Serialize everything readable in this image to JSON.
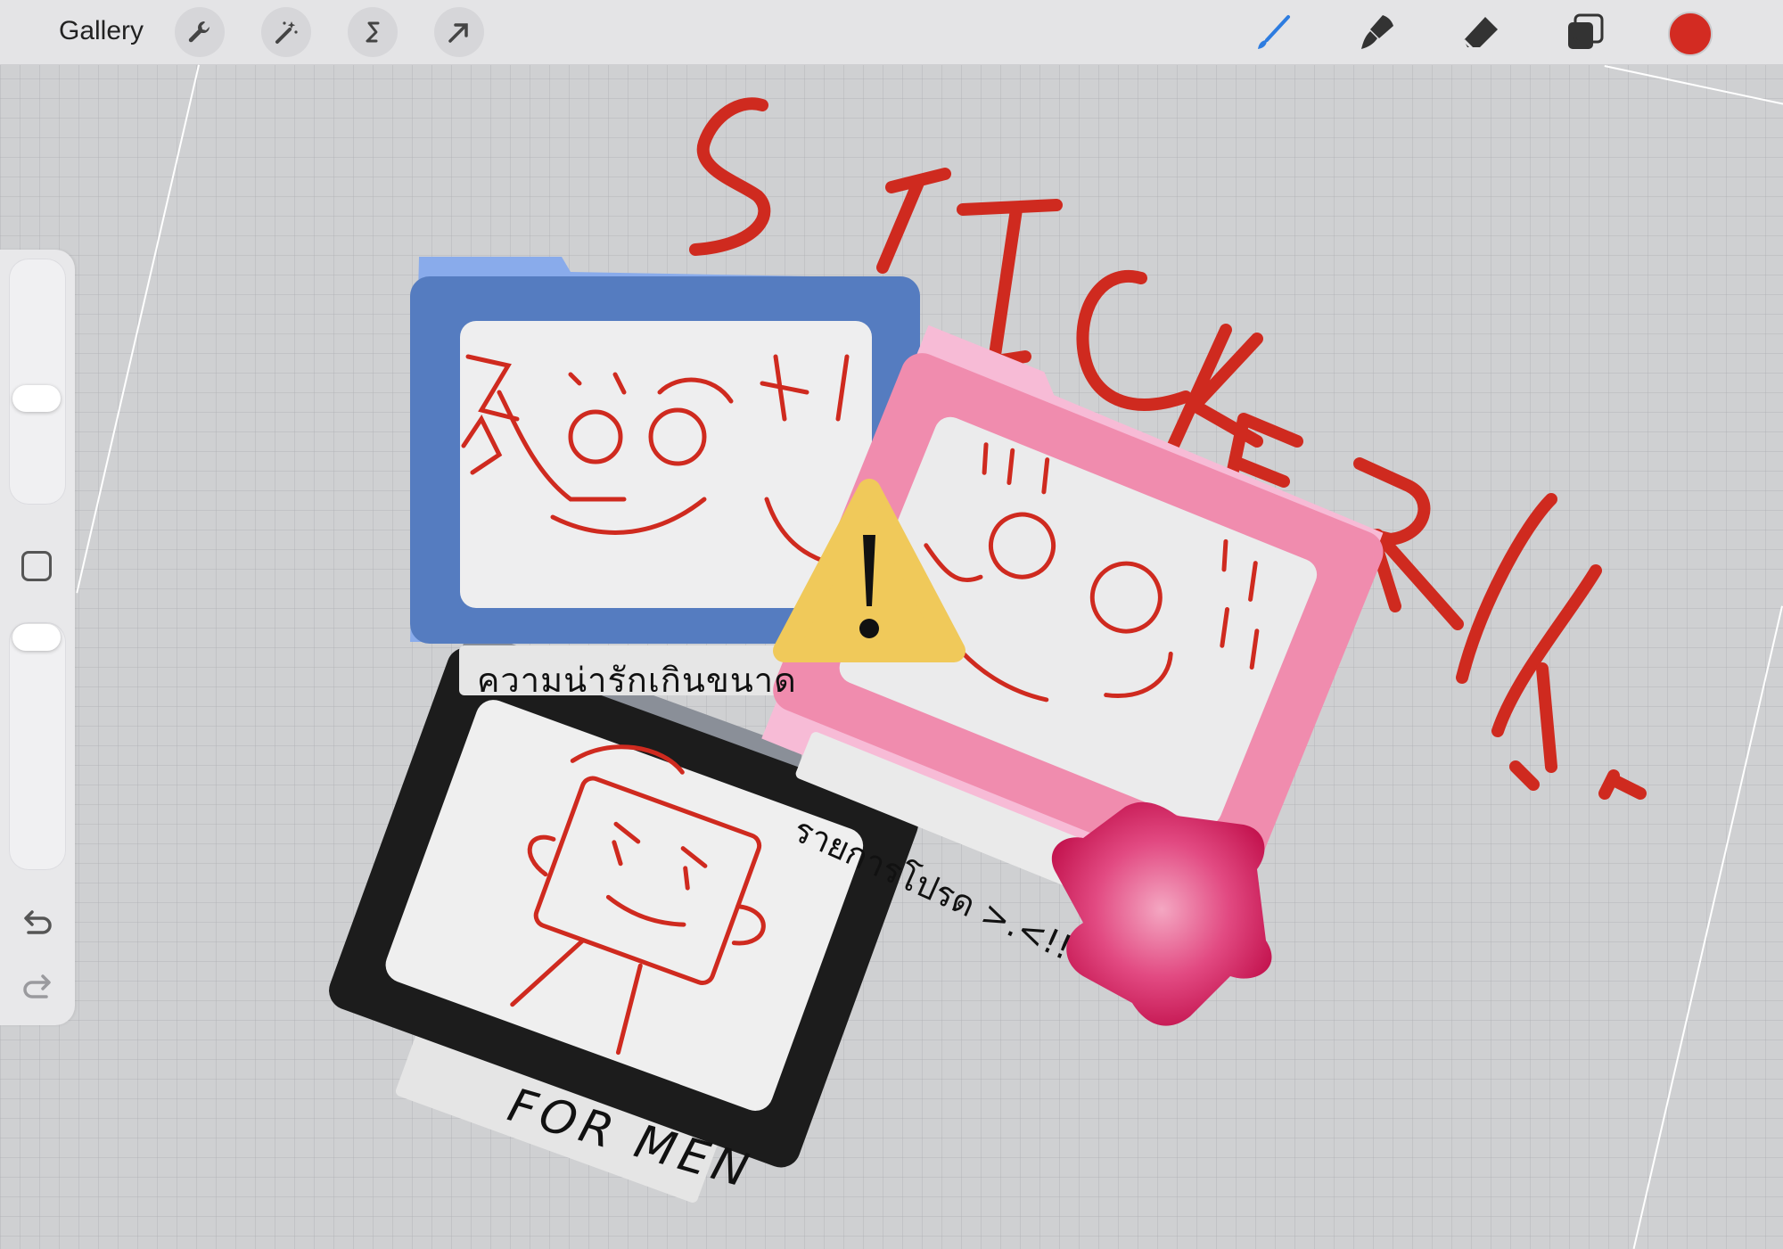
{
  "toolbar": {
    "gallery_label": "Gallery",
    "left_tools": [
      "wrench-icon",
      "magic-wand-icon",
      "selection-s-icon",
      "arrow-cursor-icon"
    ],
    "right_tools": [
      "brush-icon",
      "smudge-icon",
      "eraser-icon",
      "layers-icon"
    ],
    "accent_color": "#2d7ce0",
    "current_color": "#d32b22"
  },
  "side_panel": {
    "controls": [
      "brush-size-slider",
      "modify-button",
      "opacity-slider",
      "undo-button",
      "redo-button"
    ]
  },
  "canvas": {
    "title_text": "STICKER!!",
    "blue_folder_caption": "ความน่ารักเกินขนาด",
    "pink_folder_caption": "รายการโปรด >.<!!",
    "black_folder_caption": "FOR MEN",
    "warning_glyph": "!",
    "colors": {
      "ink_red": "#cf2a1f",
      "blue_folder": "#557cc0",
      "pink_folder": "#f08cae",
      "black_folder": "#1c1c1c",
      "warning_yellow": "#f0c95a",
      "star_pink": "#d8245e"
    }
  }
}
